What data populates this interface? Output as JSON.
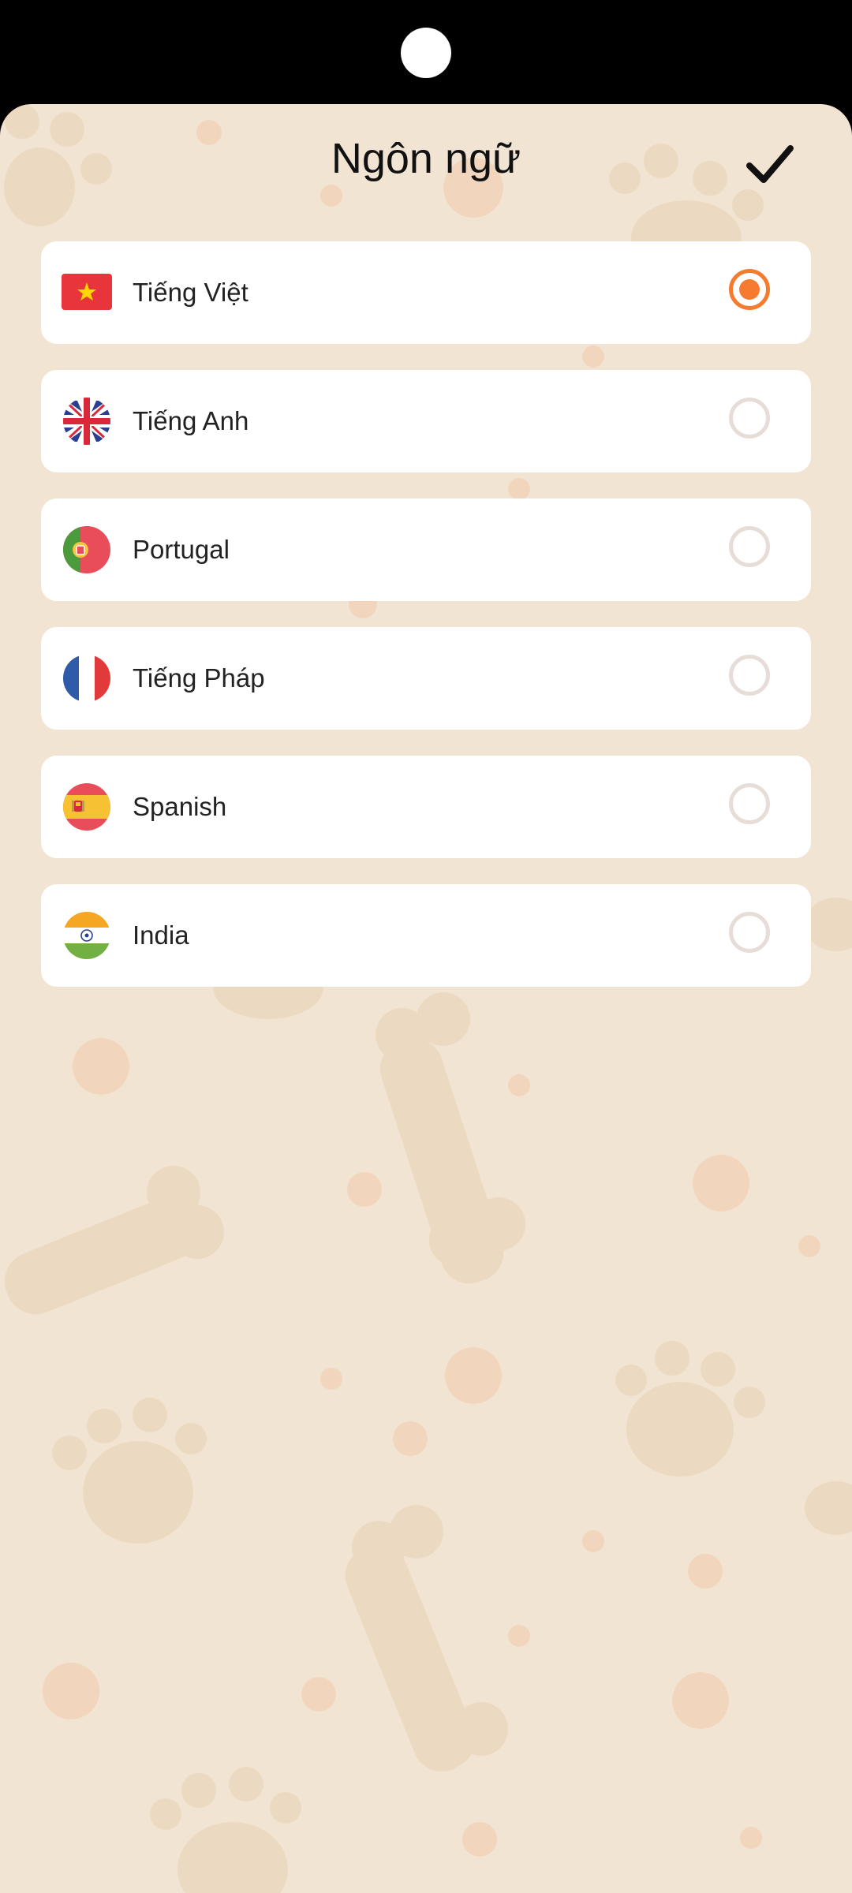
{
  "header": {
    "title": "Ngôn ngữ",
    "confirm_icon": "checkmark-icon"
  },
  "languages": [
    {
      "label": "Tiếng Việt",
      "flag": "vietnam-flag-icon",
      "selected": true
    },
    {
      "label": "Tiếng Anh",
      "flag": "uk-flag-icon",
      "selected": false
    },
    {
      "label": "Portugal",
      "flag": "portugal-flag-icon",
      "selected": false
    },
    {
      "label": "Tiếng Pháp",
      "flag": "france-flag-icon",
      "selected": false
    },
    {
      "label": "Spanish",
      "flag": "spain-flag-icon",
      "selected": false
    },
    {
      "label": "India",
      "flag": "india-flag-icon",
      "selected": false
    }
  ],
  "colors": {
    "background": "#f2e4d3",
    "accent": "#f47b30",
    "radio_unselected": "#e6ddd8",
    "card": "#ffffff"
  }
}
